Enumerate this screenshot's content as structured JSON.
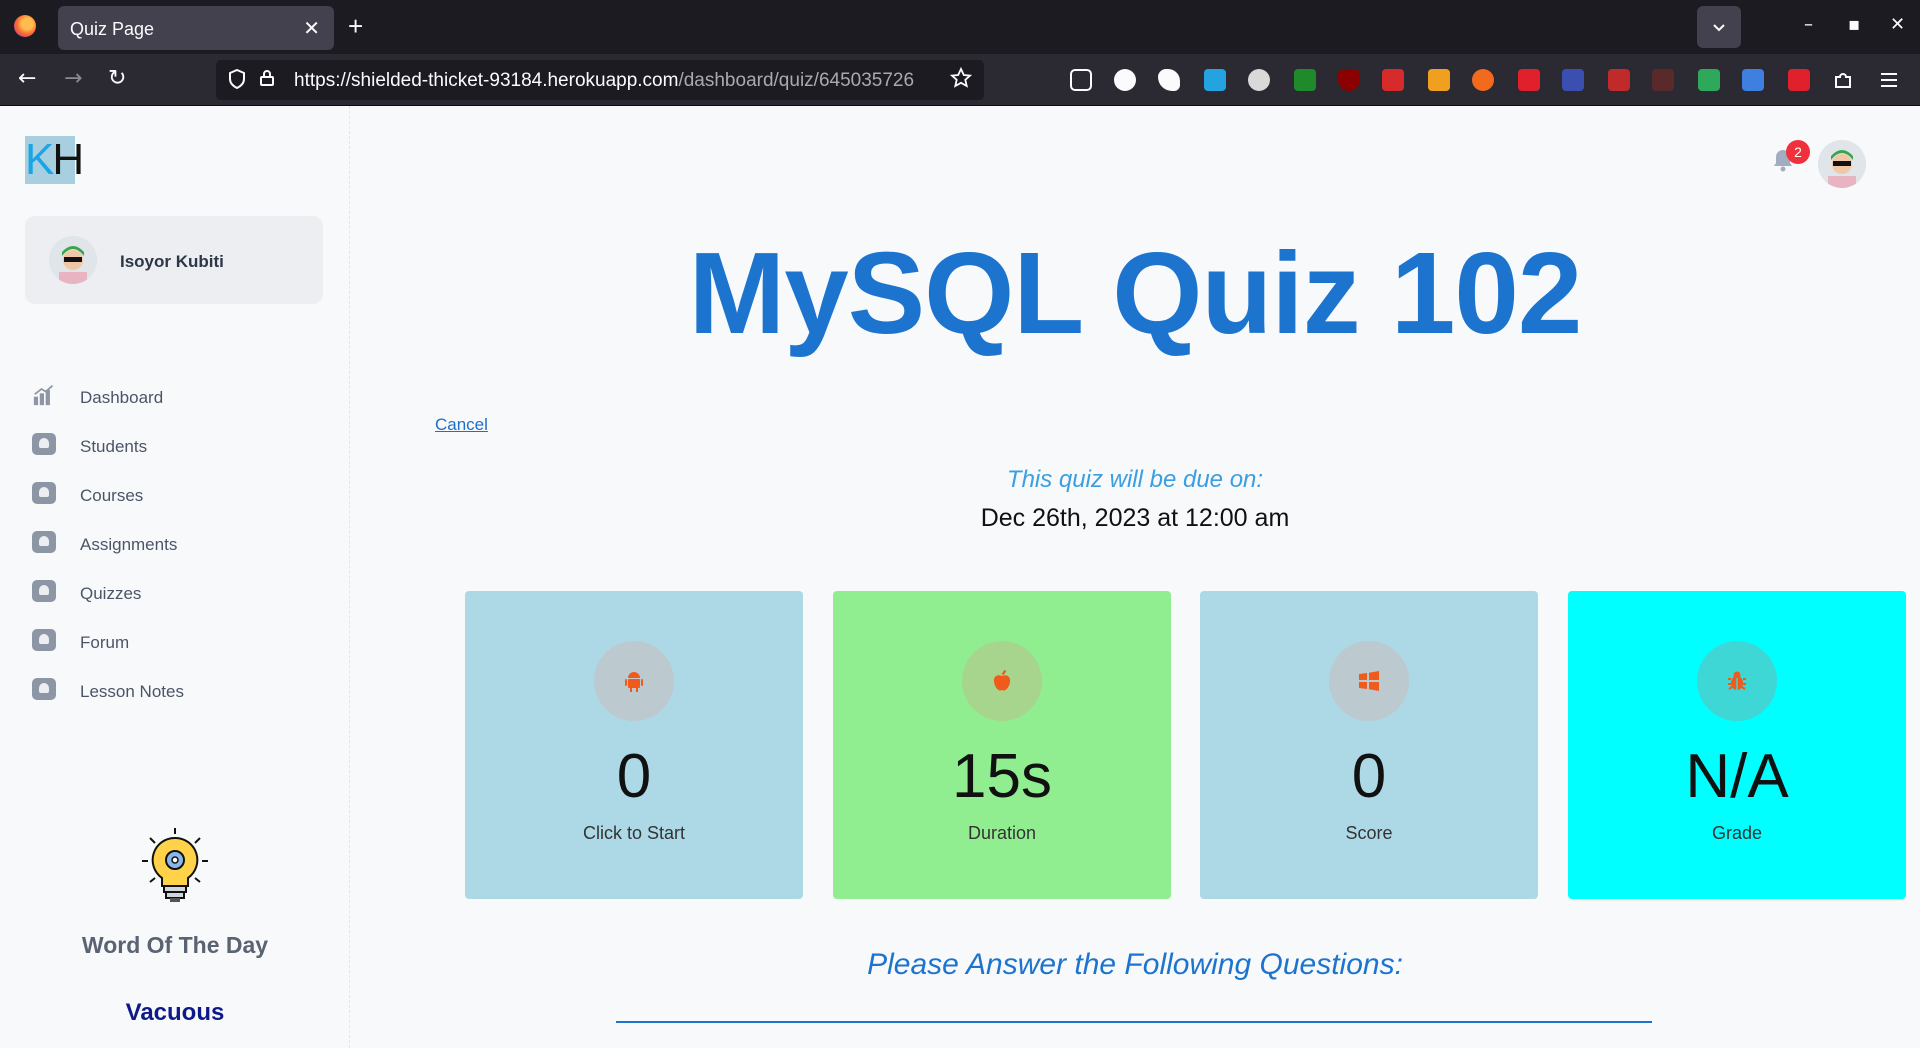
{
  "browser": {
    "tab_title": "Quiz Page",
    "tab_close": "✕",
    "new_tab": "+",
    "url_host": "https://shielded-thicket-93184.herokuapp.com",
    "url_path": "/dashboard/quiz/645035726",
    "controls": {
      "minimize": "–",
      "maximize": "▪",
      "close": "✕"
    }
  },
  "sidebar": {
    "logo_k": "K",
    "logo_h": "H",
    "profile_name": "Isoyor Kubiti",
    "menu": [
      {
        "label": "Dashboard",
        "icon": "chart-icon"
      },
      {
        "label": "Students",
        "icon": "user-icon"
      },
      {
        "label": "Courses",
        "icon": "book-icon"
      },
      {
        "label": "Assignments",
        "icon": "book-icon"
      },
      {
        "label": "Quizzes",
        "icon": "book-icon"
      },
      {
        "label": "Forum",
        "icon": "user-icon"
      },
      {
        "label": "Lesson Notes",
        "icon": "book-icon"
      }
    ],
    "word_of_day_title": "Word Of The Day",
    "word_of_day": "Vacuous"
  },
  "header": {
    "notification_count": "2"
  },
  "quiz": {
    "title": "MySQL Quiz 102",
    "cancel": "Cancel",
    "due_label": "This quiz will be due on:",
    "due_date": "Dec 26th, 2023 at 12:00 am",
    "cards": [
      {
        "value": "0",
        "label": "Click to Start",
        "icon": "android-icon",
        "color": "#add8e6"
      },
      {
        "value": "15s",
        "label": "Duration",
        "icon": "apple-icon",
        "color": "#90ee90"
      },
      {
        "value": "0",
        "label": "Score",
        "icon": "windows-icon",
        "color": "#add8e6"
      },
      {
        "value": "N/A",
        "label": "Grade",
        "icon": "bug-icon",
        "color": "#00ffff"
      }
    ],
    "answer_heading": "Please Answer the Following Questions:"
  }
}
